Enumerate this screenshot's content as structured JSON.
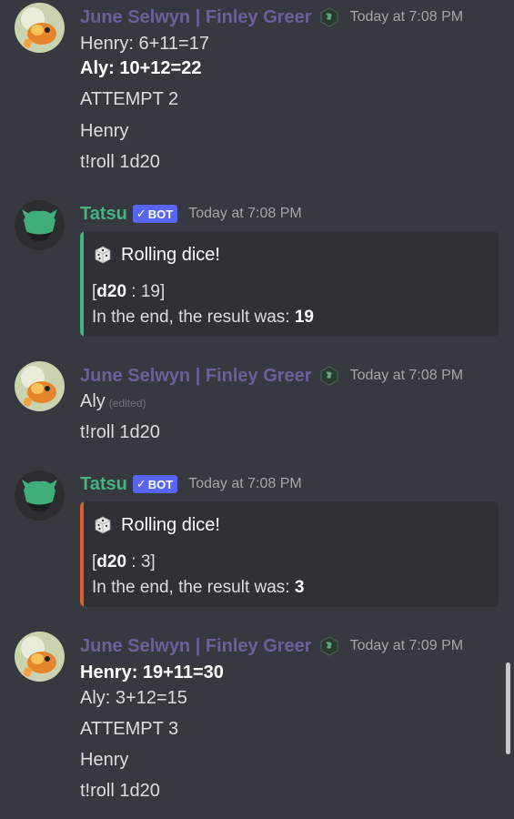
{
  "messages": [
    {
      "author": "June Selwyn | Finley Greer",
      "timestamp": "Today at 7:08 PM",
      "lines": [
        {
          "text": "Henry: 6+11=17"
        },
        {
          "text": "Aly: 10+12=22"
        },
        {
          "text": "ATTEMPT 2"
        },
        {
          "text": "Henry"
        },
        {
          "text": "t!roll 1d20"
        }
      ]
    },
    {
      "author": "Tatsu",
      "bot_tag": "BOT",
      "timestamp": "Today at 7:08 PM",
      "embed": {
        "color": "#43b581",
        "title": "Rolling dice!",
        "roll_open": "[",
        "roll_die": "d20",
        "roll_rest": " : 19]",
        "result_prefix": "In the end, the result was: ",
        "result_value": "19"
      }
    },
    {
      "author": "June Selwyn | Finley Greer",
      "timestamp": "Today at 7:08 PM",
      "lines": [
        {
          "text": "Aly",
          "edited": "(edited)"
        },
        {
          "text": "t!roll 1d20"
        }
      ]
    },
    {
      "author": "Tatsu",
      "bot_tag": "BOT",
      "timestamp": "Today at 7:08 PM",
      "embed": {
        "color": "#e0602c",
        "title": "Rolling dice!",
        "roll_open": "[",
        "roll_die": "d20",
        "roll_rest": " : 3]",
        "result_prefix": "In the end, the result was: ",
        "result_value": "3"
      }
    },
    {
      "author": "June Selwyn | Finley Greer",
      "timestamp": "Today at 7:09 PM",
      "lines": [
        {
          "text": "Henry: 19+11=30"
        },
        {
          "text": "Aly: 3+12=15"
        },
        {
          "text": "ATTEMPT 3"
        },
        {
          "text": "Henry"
        },
        {
          "text": "t!roll 1d20"
        }
      ]
    }
  ],
  "colors": {
    "background": "#36393f",
    "june_name": "#6e5f9c",
    "tatsu_name": "#43b581",
    "bot_tag": "#5865f2",
    "embed_bg": "#2f3136"
  },
  "icons": {
    "june_avatar": "goldfish-avatar",
    "tatsu_avatar": "green-fox-avatar",
    "role": "dragon-role-icon",
    "embed": "dice-icon",
    "bot_verified": "check-icon"
  }
}
